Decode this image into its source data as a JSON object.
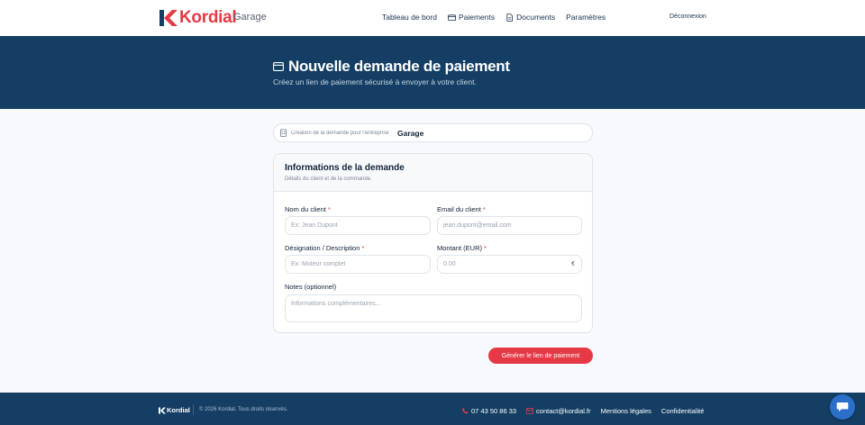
{
  "header": {
    "brand_name": "Kordial",
    "brand_sub": "Garage",
    "nav": [
      {
        "label": "Tableau de bord",
        "icon": null
      },
      {
        "label": "Paiements",
        "icon": "card-icon"
      },
      {
        "label": "Documents",
        "icon": "document-icon"
      },
      {
        "label": "Paramètres",
        "icon": null
      }
    ],
    "logout_label": "Déconnexion"
  },
  "hero": {
    "title": "Nouvelle demande de paiement",
    "subtitle": "Créez un lien de paiement sécurisé à envoyer à votre client."
  },
  "company": {
    "label": "Création de la demande pour l'entreprise",
    "value": "Garage"
  },
  "form": {
    "title": "Informations de la demande",
    "subtitle": "Détails du client et de la commande.",
    "client_name": {
      "label": "Nom du client",
      "required": "*",
      "placeholder": "Ex: Jean Dupont"
    },
    "client_email": {
      "label": "Email du client",
      "required": "*",
      "placeholder": "jean.dupont@email.com"
    },
    "designation": {
      "label": "Désignation / Description",
      "required": "*",
      "placeholder": "Ex: Moteur complet"
    },
    "amount": {
      "label": "Montant (EUR)",
      "required": "*",
      "placeholder": "0.00",
      "suffix": "€"
    },
    "notes": {
      "label": "Notes (optionnel)",
      "placeholder": "Informations complémentaires..."
    },
    "submit_label": "Générer le lien de paiement"
  },
  "footer": {
    "brand": "Kordial",
    "copyright": "© 2026 Kordial. Tous droits réservés.",
    "phone": "07 43 50 86 33",
    "email": "contact@kordial.fr",
    "legal": "Mentions légales",
    "privacy": "Confidentialité"
  },
  "colors": {
    "brand_red": "#e63946",
    "navy": "#143e63",
    "chat_blue": "#2a6fc9"
  }
}
